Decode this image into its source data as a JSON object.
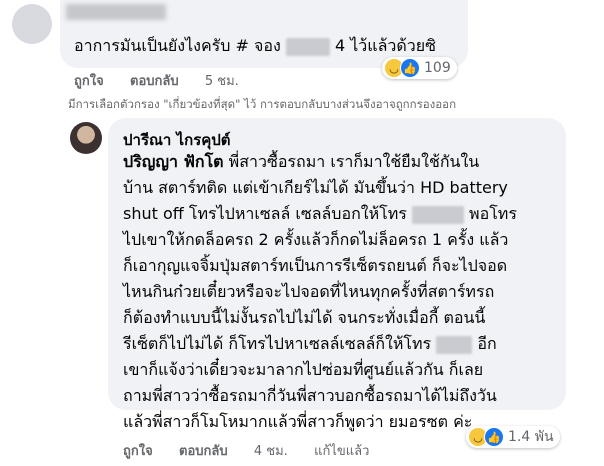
{
  "top_comment": {
    "text_before_blur": "อาการมันเป็นยังไงครับ # จอง",
    "text_after_blur": "4 ไว้แล้วด้วยซิ",
    "actions": {
      "like": "ถูกใจ",
      "reply": "ตอบกลับ",
      "time": "5 ชม."
    },
    "reaction_count": "109"
  },
  "filter_note": "มีการเลือกตัวกรอง \"เกี่ยวข้องที่สุด\" ไว้ การตอบกลับบางส่วนจึงอาจถูกกรองออก",
  "reply": {
    "author": "ปารีณา ไกรคุปต์",
    "tagged_name": "ปริญญา ฟักโต",
    "lines": [
      "พี่สาวซื้อรถมา เราก็มาใช้ยืมใช้กันใน",
      "บ้าน สตาร์ทติด แต่เข้าเกียร์ไม่ได้ มันขึ้นว่า HD battery",
      "shut off โทรไปหาเซลล์ เซลล์บอกให้โทร",
      "พอโทร",
      "ไปเขาให้กดล็อครถ 2 ครั้งแล้วก็กดไม่ล็อครถ 1 ครั้ง แล้ว",
      "ก็เอากุญแจจิ้มปุ่มสตาร์ทเป็นการรีเซ็ตรถยนต์ ก็จะไปจอด",
      "ไหนกินก๋วยเตี๋ยวหรือจะไปจอดที่ไหนทุกครั้งที่สตาร์ทรถ",
      "ก็ต้องทำแบบนี้ไม่งั้นรถไปไม่ได้ จนกระทั่งเมื่อกี้ ตอนนี้",
      "รีเซ็ตก็ไปไม่ได้ ก็โทรไปหาเซลล์เซลล์ก็ให้โทร",
      "อีก",
      "เขาก็แจ้งว่าเดี๋ยวจะมาลากไปซ่อมที่ศูนย์แล้วกัน ก็เลย",
      "ถามพี่สาวว่าซื้อรถมากี่วันพี่สาวบอกซื้อรถมาได้ไม่ถึงวัน",
      "แล้วพี่สาวก็โมโหมากแล้วพี่สาวก็พูดว่า ยมอรซต ค่ะ"
    ],
    "actions": {
      "like": "ถูกใจ",
      "reply": "ตอบกลับ",
      "time": "4 ชม.",
      "edited": "แก้ไขแล้ว"
    },
    "reaction_count": "1.4 พัน"
  }
}
